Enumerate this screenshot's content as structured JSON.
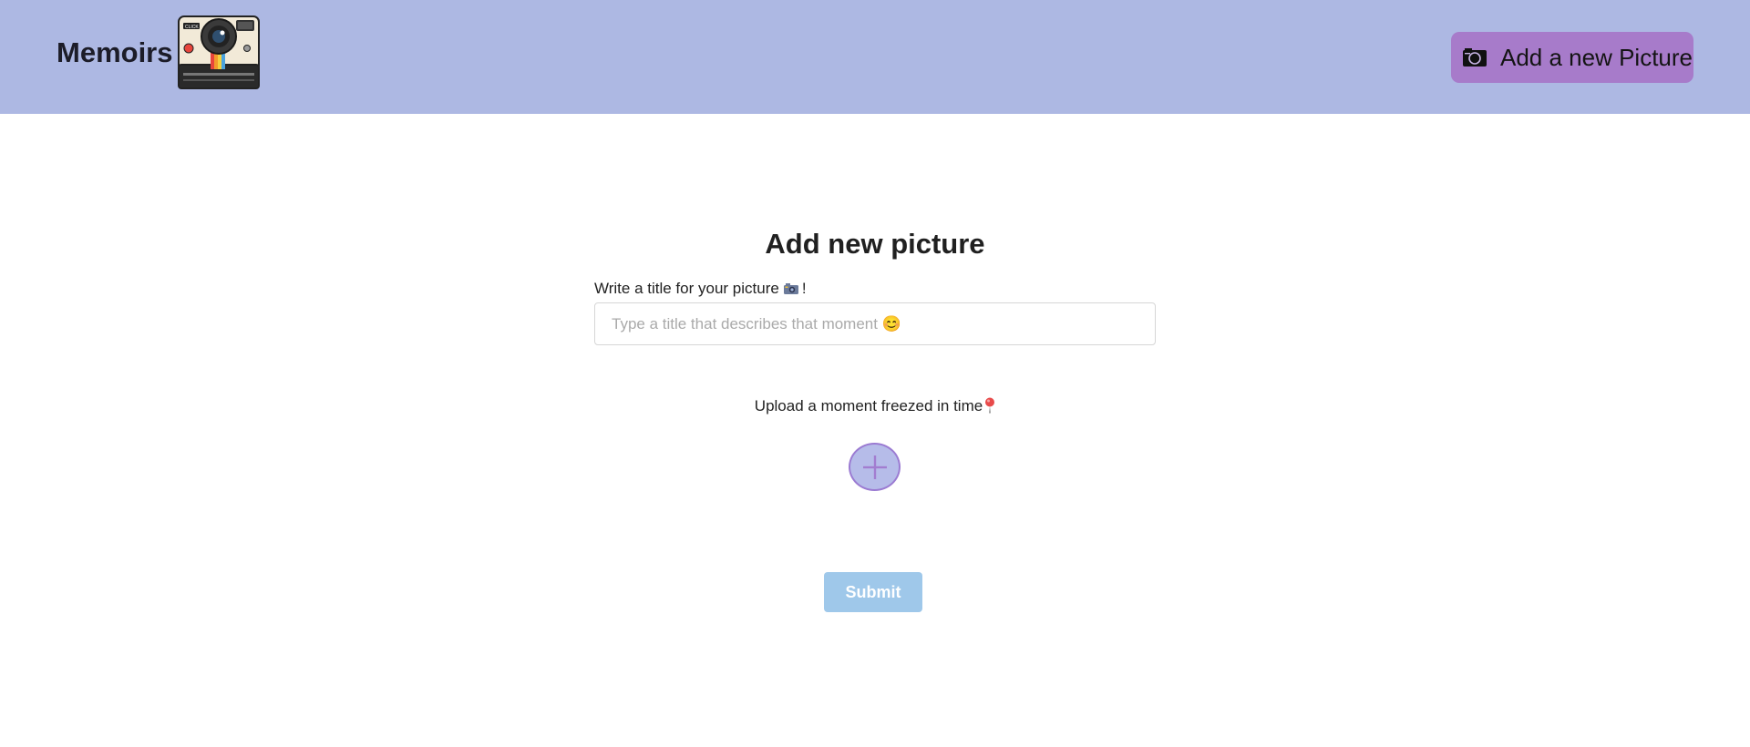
{
  "header": {
    "brand_title": "Memoirs",
    "logo_text": "CLICK",
    "add_button_label": "Add a new Picture",
    "background_color": "#adb8e3",
    "button_color": "#a77bca"
  },
  "form": {
    "heading": "Add new picture",
    "title_label_before": "Write a title for your picture",
    "title_label_after": "!",
    "title_placeholder": "Type a title that describes that moment 😊",
    "title_value": "",
    "upload_label": "Upload a moment freezed in time",
    "upload_icon": "plus-icon",
    "submit_label": "Submit",
    "submit_color": "#9fc8ea"
  }
}
